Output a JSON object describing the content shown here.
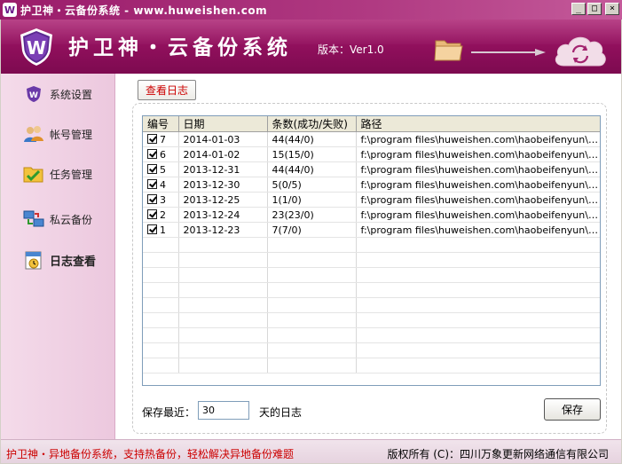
{
  "window": {
    "title": "护卫神・云备份系统 - www.huweishen.com",
    "icon": "shield-w-icon",
    "buttons": [
      "_",
      "□",
      "×"
    ]
  },
  "banner": {
    "title": "护卫神・云备份系统",
    "version": "版本：Ver1.0",
    "colors": {
      "primary": "#8e0f5b",
      "accent": "#a8196d"
    }
  },
  "sidebar": {
    "items": [
      {
        "label": "系统设置",
        "icon": "system-settings-icon"
      },
      {
        "label": "帐号管理",
        "icon": "account-users-icon"
      },
      {
        "label": "任务管理",
        "icon": "task-folder-icon"
      },
      {
        "label": "私云备份",
        "icon": "private-cloud-icon"
      },
      {
        "label": "日志查看",
        "icon": "log-calendar-icon",
        "active": true
      }
    ]
  },
  "content": {
    "tab_label": "查看日志",
    "table": {
      "columns": [
        "编号",
        "日期",
        "条数(成功/失败)",
        "路径"
      ],
      "rows": [
        {
          "id": "7",
          "date": "2014-01-03",
          "count": "44(44/0)",
          "path": "f:\\program files\\huweishen.com\\haobeifenyun\\Yunl..."
        },
        {
          "id": "6",
          "date": "2014-01-02",
          "count": "15(15/0)",
          "path": "f:\\program files\\huweishen.com\\haobeifenyun\\Yunl..."
        },
        {
          "id": "5",
          "date": "2013-12-31",
          "count": "44(44/0)",
          "path": "f:\\program files\\huweishen.com\\haobeifenyun\\Yunl..."
        },
        {
          "id": "4",
          "date": "2013-12-30",
          "count": "5(0/5)",
          "path": "f:\\program files\\huweishen.com\\haobeifenyun\\Yunl..."
        },
        {
          "id": "3",
          "date": "2013-12-25",
          "count": "1(1/0)",
          "path": "f:\\program files\\huweishen.com\\haobeifenyun\\Yunl..."
        },
        {
          "id": "2",
          "date": "2013-12-24",
          "count": "23(23/0)",
          "path": "f:\\program files\\huweishen.com\\haobeifenyun\\Yunl..."
        },
        {
          "id": "1",
          "date": "2013-12-23",
          "count": "7(7/0)",
          "path": "f:\\program files\\huweishen.com\\haobeifenyun\\Yunl..."
        }
      ]
    },
    "keep_label": "保存最近：",
    "keep_value": "30",
    "keep_suffix": "天的日志",
    "save_label": "保存"
  },
  "statusbar": {
    "left": "护卫神・异地备份系统，支持热备份，轻松解决异地备份难题",
    "right": "版权所有 (C)：四川万象更新网络通信有限公司"
  }
}
